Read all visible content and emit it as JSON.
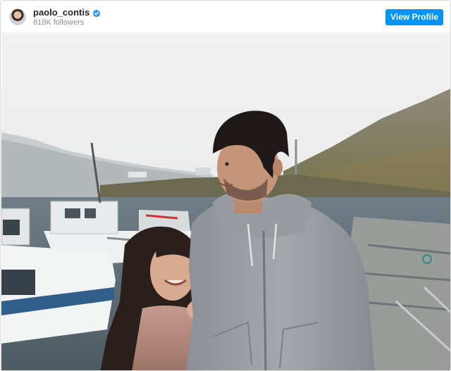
{
  "header": {
    "username": "paolo_contis",
    "verified": true,
    "followers": "818K followers",
    "view_profile_label": "View Profile"
  },
  "colors": {
    "accent": "#0095f6",
    "verified_badge": "#3897f0"
  },
  "post": {
    "media_type": "photo"
  }
}
